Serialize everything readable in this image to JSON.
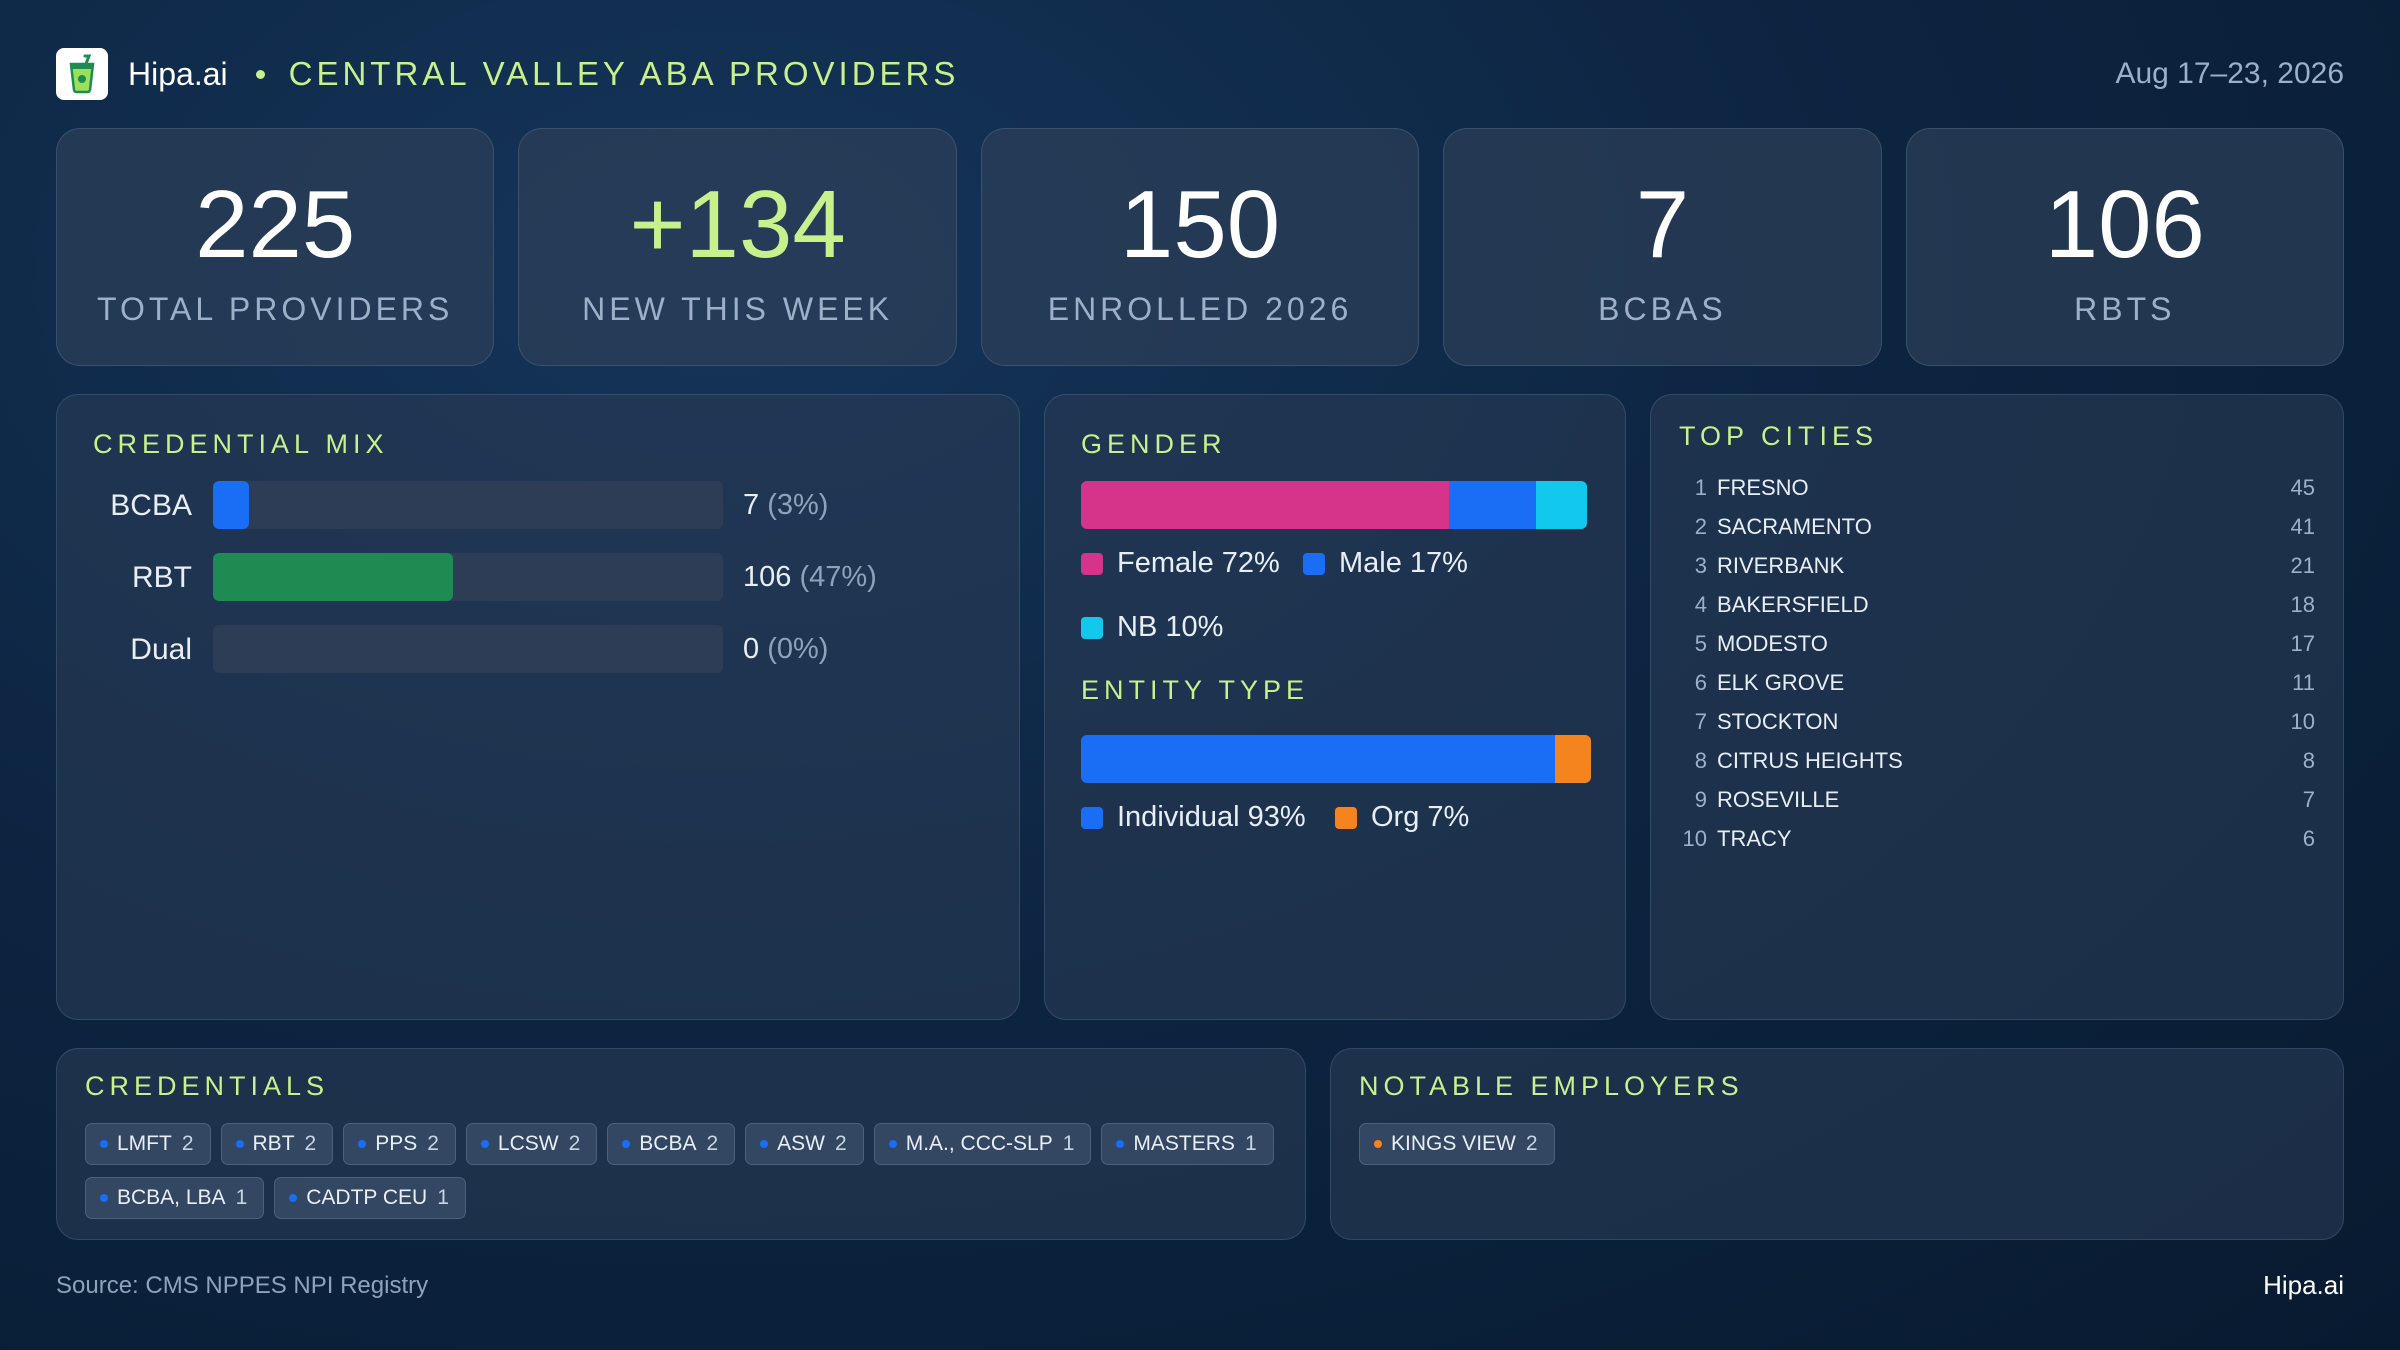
{
  "header": {
    "brand": "Hipa.ai",
    "title": "CENTRAL VALLEY ABA PROVIDERS",
    "date": "Aug 17–23, 2026",
    "logo_icon": "drink-cup-icon"
  },
  "stats": [
    {
      "value": "225",
      "label": "TOTAL PROVIDERS"
    },
    {
      "value": "+134",
      "label": "NEW THIS WEEK"
    },
    {
      "value": "150",
      "label": "ENROLLED 2026"
    },
    {
      "value": "7",
      "label": "BCBAS"
    },
    {
      "value": "106",
      "label": "RBTS"
    }
  ],
  "colors": {
    "accent": "#c8f08c",
    "bcba": "#1a6ef5",
    "rbt": "#1e8c52",
    "female": "#d6338a",
    "male": "#1a6ef5",
    "nb": "#12c8ec",
    "individual": "#1a6ef5",
    "org": "#f5841f"
  },
  "chart_data": [
    {
      "type": "bar",
      "title": "CREDENTIAL MIX",
      "categories": [
        "BCBA",
        "RBT",
        "Dual"
      ],
      "values": [
        7,
        106,
        0
      ],
      "value_labels": [
        "7",
        "106",
        "0"
      ],
      "percent_labels": [
        "(3%)",
        "(47%)",
        "(0%)"
      ],
      "percents": [
        3,
        47,
        0
      ],
      "xlim": [
        0,
        225
      ],
      "colors": [
        "#1a6ef5",
        "#1e8c52",
        "#1a6ef5"
      ]
    },
    {
      "type": "bar",
      "title": "GENDER",
      "stacked": true,
      "series": [
        {
          "name": "Female",
          "value": 72,
          "label": "Female 72%",
          "color": "#d6338a"
        },
        {
          "name": "Male",
          "value": 17,
          "label": "Male 17%",
          "color": "#1a6ef5"
        },
        {
          "name": "NB",
          "value": 10,
          "label": "NB 10%",
          "color": "#12c8ec"
        }
      ]
    },
    {
      "type": "bar",
      "title": "ENTITY TYPE",
      "stacked": true,
      "series": [
        {
          "name": "Individual",
          "value": 93,
          "label": "Individual 93%",
          "color": "#1a6ef5"
        },
        {
          "name": "Org",
          "value": 7,
          "label": "Org 7%",
          "color": "#f5841f"
        }
      ]
    },
    {
      "type": "table",
      "title": "TOP CITIES",
      "rows": [
        {
          "rank": "1",
          "city": "FRESNO",
          "count": "45"
        },
        {
          "rank": "2",
          "city": "SACRAMENTO",
          "count": "41"
        },
        {
          "rank": "3",
          "city": "RIVERBANK",
          "count": "21"
        },
        {
          "rank": "4",
          "city": "BAKERSFIELD",
          "count": "18"
        },
        {
          "rank": "5",
          "city": "MODESTO",
          "count": "17"
        },
        {
          "rank": "6",
          "city": "ELK GROVE",
          "count": "11"
        },
        {
          "rank": "7",
          "city": "STOCKTON",
          "count": "10"
        },
        {
          "rank": "8",
          "city": "CITRUS HEIGHTS",
          "count": "8"
        },
        {
          "rank": "9",
          "city": "ROSEVILLE",
          "count": "7"
        },
        {
          "rank": "10",
          "city": "TRACY",
          "count": "6"
        }
      ]
    }
  ],
  "credentials": {
    "title": "CREDENTIALS",
    "chips": [
      {
        "label": "LMFT",
        "count": "2"
      },
      {
        "label": "RBT",
        "count": "2"
      },
      {
        "label": "PPS",
        "count": "2"
      },
      {
        "label": "LCSW",
        "count": "2"
      },
      {
        "label": "BCBA",
        "count": "2"
      },
      {
        "label": "ASW",
        "count": "2"
      },
      {
        "label": "M.A., CCC-SLP",
        "count": "1"
      },
      {
        "label": "MASTERS",
        "count": "1"
      },
      {
        "label": "BCBA, LBA",
        "count": "1"
      },
      {
        "label": "CADTP CEU",
        "count": "1"
      }
    ]
  },
  "employers": {
    "title": "NOTABLE EMPLOYERS",
    "chips": [
      {
        "label": "KINGS VIEW",
        "count": "2"
      }
    ]
  },
  "footer": {
    "source": "Source: CMS NPPES NPI Registry",
    "brand": "Hipa.ai"
  }
}
